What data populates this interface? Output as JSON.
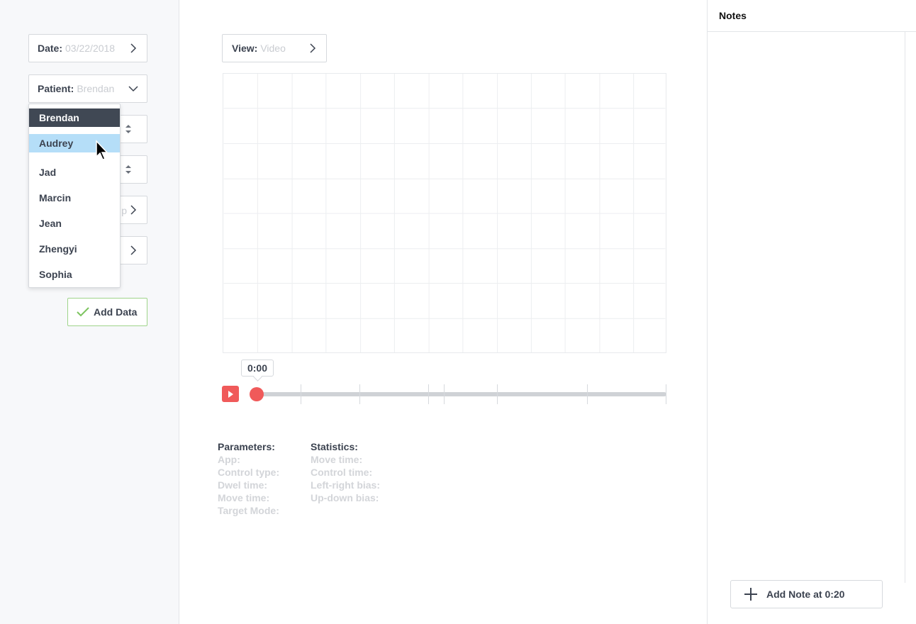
{
  "sidebar": {
    "date": {
      "label": "Date:",
      "value": "03/22/2018"
    },
    "patient": {
      "label": "Patient:",
      "value": "Brendan"
    },
    "partial_field_text": "p",
    "patient_options": [
      "Brendan",
      "Audrey",
      "Jad",
      "Marcin",
      "Jean",
      "Zhengyi",
      "Sophia"
    ],
    "selected_option": "Brendan",
    "hovered_option": "Audrey",
    "add_data_label": "Add Data"
  },
  "main": {
    "view": {
      "label": "View:",
      "value": "Video"
    },
    "time": "0:00",
    "parameters": {
      "title": "Parameters:",
      "items": [
        "App:",
        "Control type:",
        "Dwel time:",
        "Move time:",
        "Target Mode:"
      ]
    },
    "statistics": {
      "title": "Statistics:",
      "items": [
        "Move time:",
        "Control time:",
        "Left-right bias:",
        "Up-down bias:"
      ]
    }
  },
  "notes": {
    "title": "Notes",
    "add_note_label": "Add Note at 0:20"
  },
  "colors": {
    "accent_red": "#f05a5a",
    "hover_blue": "#b5def8",
    "selected_dark": "#404854",
    "success_green": "#7cc45f"
  }
}
